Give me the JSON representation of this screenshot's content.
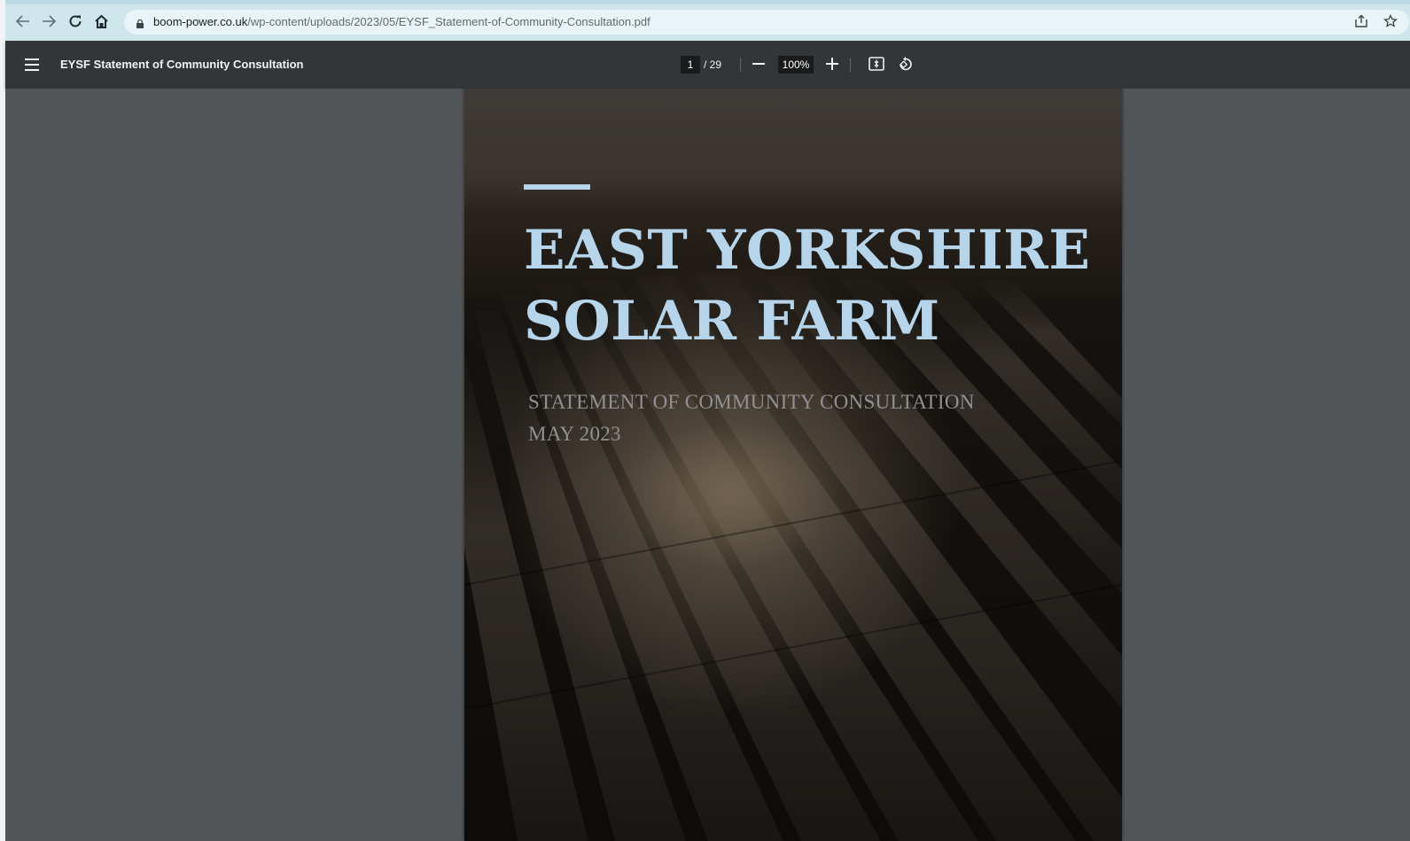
{
  "browser": {
    "url_host": "boom-power.co.uk",
    "url_path": "/wp-content/uploads/2023/05/EYSF_Statement-of-Community-Consultation.pdf"
  },
  "pdf_toolbar": {
    "title": "EYSF Statement of Community Consultation",
    "current_page": "1",
    "total_pages": "/ 29",
    "zoom": "100%"
  },
  "document": {
    "title_line1": "EAST YORKSHIRE",
    "title_line2": "SOLAR FARM",
    "subtitle": "STATEMENT OF COMMUNITY CONSULTATION",
    "date": "MAY 2023"
  },
  "colors": {
    "title": "#b6d5ea",
    "subtitle": "#8f9193",
    "toolbar": "#323639",
    "viewer_bg": "#525659",
    "browser_bar": "#cfe6ec"
  },
  "icons": {
    "back": "arrow-left",
    "forward": "arrow-right",
    "reload": "reload",
    "home": "home",
    "lock": "lock",
    "share": "share",
    "bookmark": "star",
    "menu": "hamburger",
    "zoom_out": "minus",
    "zoom_in": "plus",
    "fit": "fit-to-page",
    "rotate": "rotate-counterclockwise"
  }
}
